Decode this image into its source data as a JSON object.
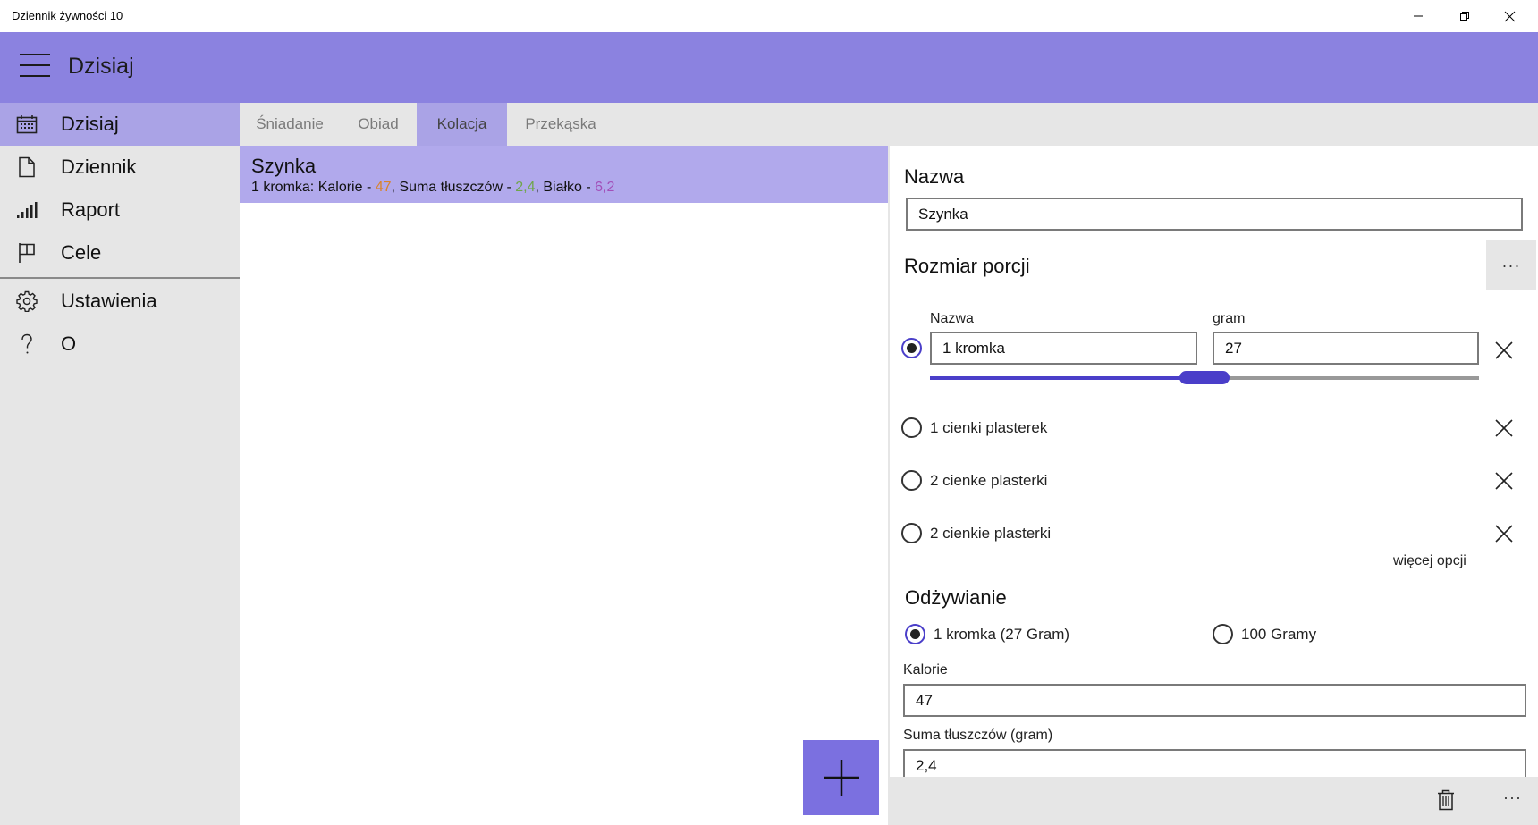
{
  "window": {
    "title": "Dziennik żywności 10"
  },
  "header": {
    "title": "Dzisiaj"
  },
  "sidebar": {
    "items": [
      {
        "label": "Dzisiaj",
        "icon": "calendar-icon",
        "active": true
      },
      {
        "label": "Dziennik",
        "icon": "document-icon"
      },
      {
        "label": "Raport",
        "icon": "bar-chart-icon"
      },
      {
        "label": "Cele",
        "icon": "flag-icon"
      },
      {
        "label": "Ustawienia",
        "icon": "gear-icon"
      },
      {
        "label": "O",
        "icon": "question-icon"
      }
    ]
  },
  "tabs": [
    {
      "label": "Śniadanie"
    },
    {
      "label": "Obiad"
    },
    {
      "label": "Kolacja",
      "active": true
    },
    {
      "label": "Przekąska"
    }
  ],
  "list": {
    "items": [
      {
        "title": "Szynka",
        "serving": "1 kromka: Kalorie - ",
        "calories": "47",
        "fat_label": ", Suma tłuszczów - ",
        "fat": "2,4",
        "protein_label": ", Białko - ",
        "protein": "6,2"
      }
    ]
  },
  "detail": {
    "name_heading": "Nazwa",
    "name_value": "Szynka",
    "portion_heading": "Rozmiar porcji",
    "more_label": "···",
    "portion_name_label": "Nazwa",
    "portion_gram_label": "gram",
    "portion_name_value": "1 kromka",
    "portion_gram_value": "27",
    "slider_value_fraction": 0.5,
    "portions": [
      {
        "label": "1 cienki plasterek"
      },
      {
        "label": "2 cienke plasterki"
      },
      {
        "label": "2 cienkie plasterki"
      }
    ],
    "more_options": "więcej opcji",
    "nutrition_heading": "Odżywianie",
    "nutrition_option_1": "1 kromka (27 Gram)",
    "nutrition_option_2": "100  Gramy",
    "calories_label": "Kalorie",
    "calories_value": "47",
    "fat_label": "Suma tłuszczów (gram)",
    "fat_value": "2,4"
  },
  "bottom_bar": {
    "more_label": "···"
  },
  "colors": {
    "accent": "#8b82e0",
    "selection": "#aaa3e6",
    "fab": "#7b70e0",
    "slider": "#4a3ec9"
  }
}
